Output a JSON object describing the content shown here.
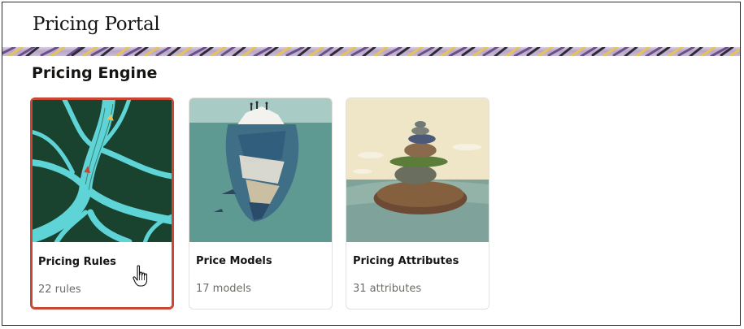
{
  "header": {
    "title": "Pricing Portal"
  },
  "section": {
    "title": "Pricing Engine"
  },
  "cards": [
    {
      "title": "Pricing Rules",
      "subtitle": "22 rules",
      "selected": true,
      "image": "river-roots-illustration"
    },
    {
      "title": "Price Models",
      "subtitle": "17 models",
      "selected": false,
      "image": "iceberg-illustration"
    },
    {
      "title": "Pricing Attributes",
      "subtitle": "31 attributes",
      "selected": false,
      "image": "stacked-stones-illustration"
    }
  ],
  "colors": {
    "selected_border": "#c74634",
    "text_primary": "#161513",
    "text_secondary": "#6f6c68"
  },
  "icons": {
    "cursor": "hand-pointer-icon"
  }
}
